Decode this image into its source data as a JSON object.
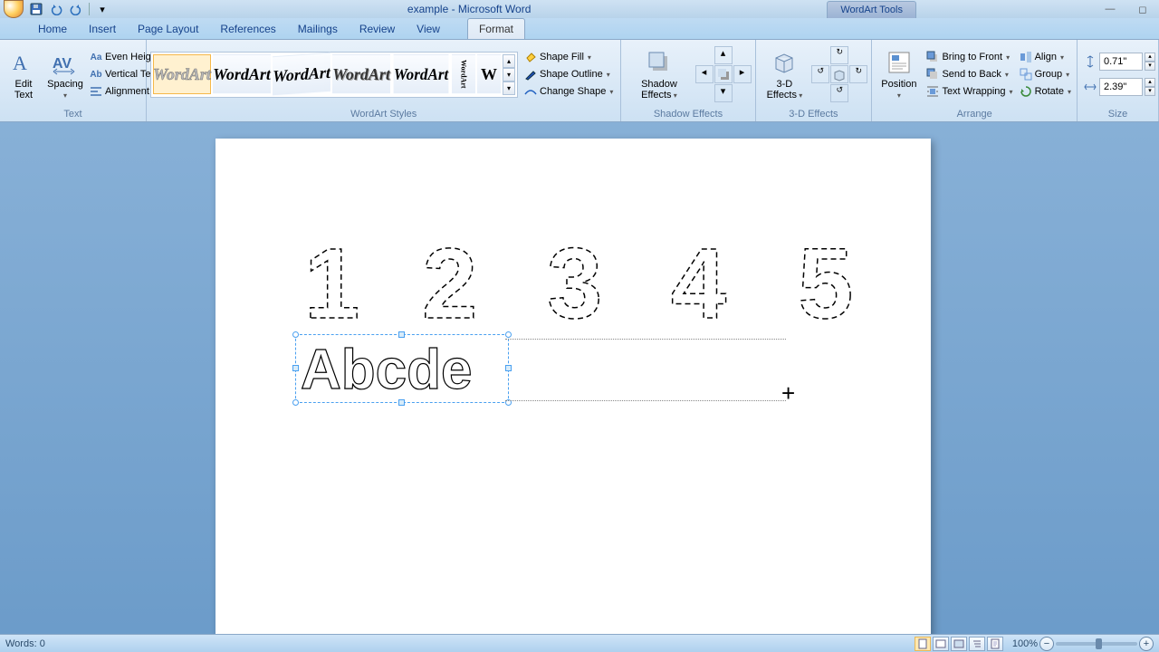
{
  "titlebar": {
    "doc_title": "example - Microsoft Word",
    "context_tools": "WordArt Tools"
  },
  "tabs": {
    "home": "Home",
    "insert": "Insert",
    "page_layout": "Page Layout",
    "references": "References",
    "mailings": "Mailings",
    "review": "Review",
    "view": "View",
    "format": "Format"
  },
  "ribbon": {
    "text": {
      "label": "Text",
      "edit_text": "Edit Text",
      "spacing": "Spacing",
      "even_height": "Even Height",
      "vertical_text": "Vertical Text",
      "alignment": "Alignment"
    },
    "wordart_styles": {
      "label": "WordArt Styles",
      "sample": "WordArt",
      "shape_fill": "Shape Fill",
      "shape_outline": "Shape Outline",
      "change_shape": "Change Shape"
    },
    "shadow": {
      "label": "Shadow Effects",
      "button": "Shadow Effects"
    },
    "threed": {
      "label": "3-D Effects",
      "button": "3-D Effects"
    },
    "arrange": {
      "label": "Arrange",
      "position": "Position",
      "bring_front": "Bring to Front",
      "send_back": "Send to Back",
      "text_wrap": "Text Wrapping",
      "align": "Align",
      "group": "Group",
      "rotate": "Rotate"
    },
    "size": {
      "label": "Size",
      "height": "0.71\"",
      "width": "2.39\""
    }
  },
  "document": {
    "numbers": "1 2 3 4 5",
    "letters": "Abcde"
  },
  "statusbar": {
    "words": "Words: 0",
    "zoom": "100%"
  }
}
